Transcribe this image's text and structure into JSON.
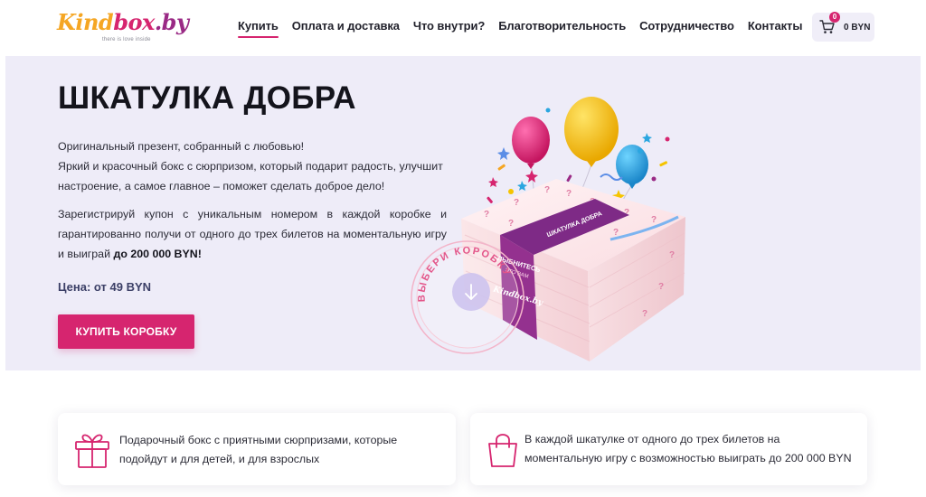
{
  "brand": {
    "logo_kind": "Kind",
    "logo_box": "box",
    "logo_by": ".by",
    "tagline": "there is love inside",
    "colors": {
      "primary": "#d6256f",
      "accent_yellow": "#f5a623",
      "purple": "#9a2a85",
      "hero_bg": "#eeecf8"
    }
  },
  "nav": {
    "items": [
      {
        "label": "Купить",
        "active": true
      },
      {
        "label": "Оплата и доставка"
      },
      {
        "label": "Что внутри?"
      },
      {
        "label": "Благотворительность"
      },
      {
        "label": "Сотрудничество"
      },
      {
        "label": "Контакты"
      }
    ]
  },
  "cart": {
    "count": "0",
    "total": "0 BYN",
    "icon": "cart-icon"
  },
  "hero": {
    "title": "ШКАТУЛКА ДОБРА",
    "desc_line1": "Оригинальный презент, собранный с любовью!",
    "desc_line2": "Яркий и красочный бокс с сюрпризом, который подарит радость, улучшит настроение, а самое главное – поможет сделать доброе дело!",
    "coupon_text": "Зарегистрируй купон с уникальным номером в каждой коробке и гарантированно получи от одного до трех билетов на моментальную игру и выиграй ",
    "coupon_bold": "до 200 000 BYN!",
    "price": "Цена: от 49 BYN",
    "buy_button": "КУПИТЬ КОРОБКУ",
    "choose_badge": "ВЫБЕРИ КОРОБКУ",
    "box_label_top": "ШКАТУЛКА ДОБРА",
    "box_label_mid": "УЛЫБНИТЕСЬ",
    "box_label_sub": "ЭТО ВАМ",
    "box_label_logo": "Kindbox.by"
  },
  "features": [
    {
      "icon": "gift-icon",
      "line1": "Подарочный бокс с приятными сюрпризами, которые",
      "line2": "подойдут и для детей, и для взрослых"
    },
    {
      "icon": "shopping-bag-icon",
      "line1": "В каждой шкатулке от одного до трех билетов на",
      "line2": "моментальную игру с возможностью выиграть до 200 000 BYN"
    }
  ]
}
